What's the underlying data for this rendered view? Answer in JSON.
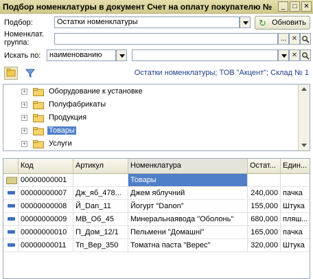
{
  "window": {
    "title": "Подбор номенклатуры в документ Счет на оплату покупателю №",
    "buttons": [
      "_",
      "□",
      "✕"
    ]
  },
  "form": {
    "podbor_label": "Подбор:",
    "podbor_value": "Остатки номенклатуры",
    "refresh_label": "Обновить",
    "group_label_line1": "Номенклат.",
    "group_label_line2": "группа:",
    "group_value": "",
    "search_label": "Искать по:",
    "search_mode": "наименованию",
    "search_value": "",
    "select_dots": "...",
    "clear_icon": "✕",
    "search_icon": "🔍"
  },
  "status_text": "Остатки номенклатуры; ТОВ \"Акцент\"; Склад № 1",
  "tree": {
    "items": [
      {
        "label": "Оборудование к установке",
        "selected": false
      },
      {
        "label": "Полуфабрикаты",
        "selected": false
      },
      {
        "label": "Продукция",
        "selected": false
      },
      {
        "label": "Товары",
        "selected": true
      },
      {
        "label": "Услуги",
        "selected": false
      }
    ]
  },
  "grid": {
    "headers": [
      "Код",
      "Артикул",
      "Номенклатура",
      "Остат...",
      "Един..."
    ],
    "rows": [
      {
        "type": "folder",
        "code": "00000000001",
        "article": "",
        "name": "Товары",
        "qty": "",
        "unit": ""
      },
      {
        "type": "item",
        "code": "00000000007",
        "article": "Дж_яб_478...",
        "name": "Джем яблучний",
        "qty": "240,000",
        "unit": "пачка"
      },
      {
        "type": "item",
        "code": "00000000008",
        "article": "Й_Dan_11",
        "name": "Йогурт \"Danon\"",
        "qty": "155,000",
        "unit": "Штука"
      },
      {
        "type": "item",
        "code": "00000000009",
        "article": "МВ_Об_45",
        "name": "Минеральнаявода \"Оболонь\"",
        "qty": "680,000",
        "unit": "пляш..."
      },
      {
        "type": "item",
        "code": "00000000010",
        "article": "П_Дом_12/1",
        "name": "Пельмени \"Домашні\"",
        "qty": "165,000",
        "unit": "пачка"
      },
      {
        "type": "item",
        "code": "00000000011",
        "article": "Тп_Вер_350",
        "name": "Томатна паста \"Верес\"",
        "qty": "320,000",
        "unit": "Штука"
      }
    ]
  },
  "colors": {
    "title_bar": "#d9d29c",
    "selection": "#4f7fc8",
    "status_text": "#1c3d8a"
  }
}
